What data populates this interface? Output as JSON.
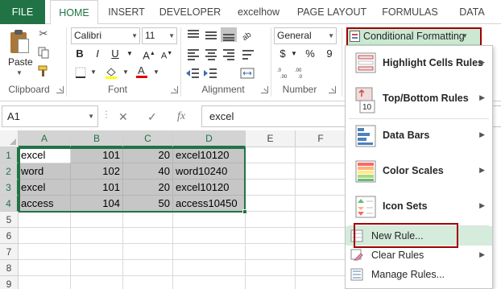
{
  "tabs": [
    "FILE",
    "HOME",
    "INSERT",
    "DEVELOPER",
    "excelhow",
    "PAGE LAYOUT",
    "FORMULAS",
    "DATA"
  ],
  "active_tab": "HOME",
  "ribbon": {
    "clipboard": {
      "paste_label": "Paste",
      "group_label": "Clipboard"
    },
    "font": {
      "font_name": "Calibri",
      "font_size": "11",
      "group_label": "Font",
      "bold": "B",
      "italic": "I",
      "underline": "U"
    },
    "alignment": {
      "group_label": "Alignment"
    },
    "number": {
      "format": "General",
      "currency": "$",
      "percent": "%",
      "comma": "9",
      "group_label": "Number"
    },
    "conditional_formatting": {
      "label": "Conditional Formatting"
    }
  },
  "formula_bar": {
    "name_box": "A1",
    "cancel": "✕",
    "enter": "✓",
    "fx": "fx",
    "content": "excel"
  },
  "sheet": {
    "columns": [
      "A",
      "B",
      "C",
      "D",
      "E",
      "F"
    ],
    "rows": [
      "1",
      "2",
      "3",
      "4",
      "5",
      "6",
      "7",
      "8",
      "9"
    ],
    "cells": [
      [
        "excel",
        "101",
        "20",
        "excel10120"
      ],
      [
        "word",
        "102",
        "40",
        "word10240"
      ],
      [
        "excel",
        "101",
        "20",
        "excel10120"
      ],
      [
        "access",
        "104",
        "50",
        "access10450"
      ]
    ]
  },
  "menu": {
    "items": [
      {
        "label": "Highlight Cells Rules",
        "icon": "highlight-cells-icon",
        "has_submenu": true
      },
      {
        "label": "Top/Bottom Rules",
        "icon": "top-bottom-icon",
        "has_submenu": true
      },
      {
        "label": "Data Bars",
        "icon": "data-bars-icon",
        "has_submenu": true
      },
      {
        "label": "Color Scales",
        "icon": "color-scales-icon",
        "has_submenu": true
      },
      {
        "label": "Icon Sets",
        "icon": "icon-sets-icon",
        "has_submenu": true
      }
    ],
    "small_items": [
      {
        "label": "New Rule...",
        "icon": "new-rule-icon",
        "has_submenu": false,
        "highlighted": true
      },
      {
        "label": "Clear Rules",
        "icon": "clear-rules-icon",
        "has_submenu": true
      },
      {
        "label": "Manage Rules...",
        "icon": "manage-rules-icon",
        "has_submenu": false
      }
    ],
    "top_bottom_icon_text": "10"
  },
  "colors": {
    "excel_green": "#217346",
    "hover_green": "#d5ecdc",
    "cf_button_bg": "#cbe8d2",
    "annotation_red": "#a00000",
    "selection_fill": "#c6c6c6"
  }
}
